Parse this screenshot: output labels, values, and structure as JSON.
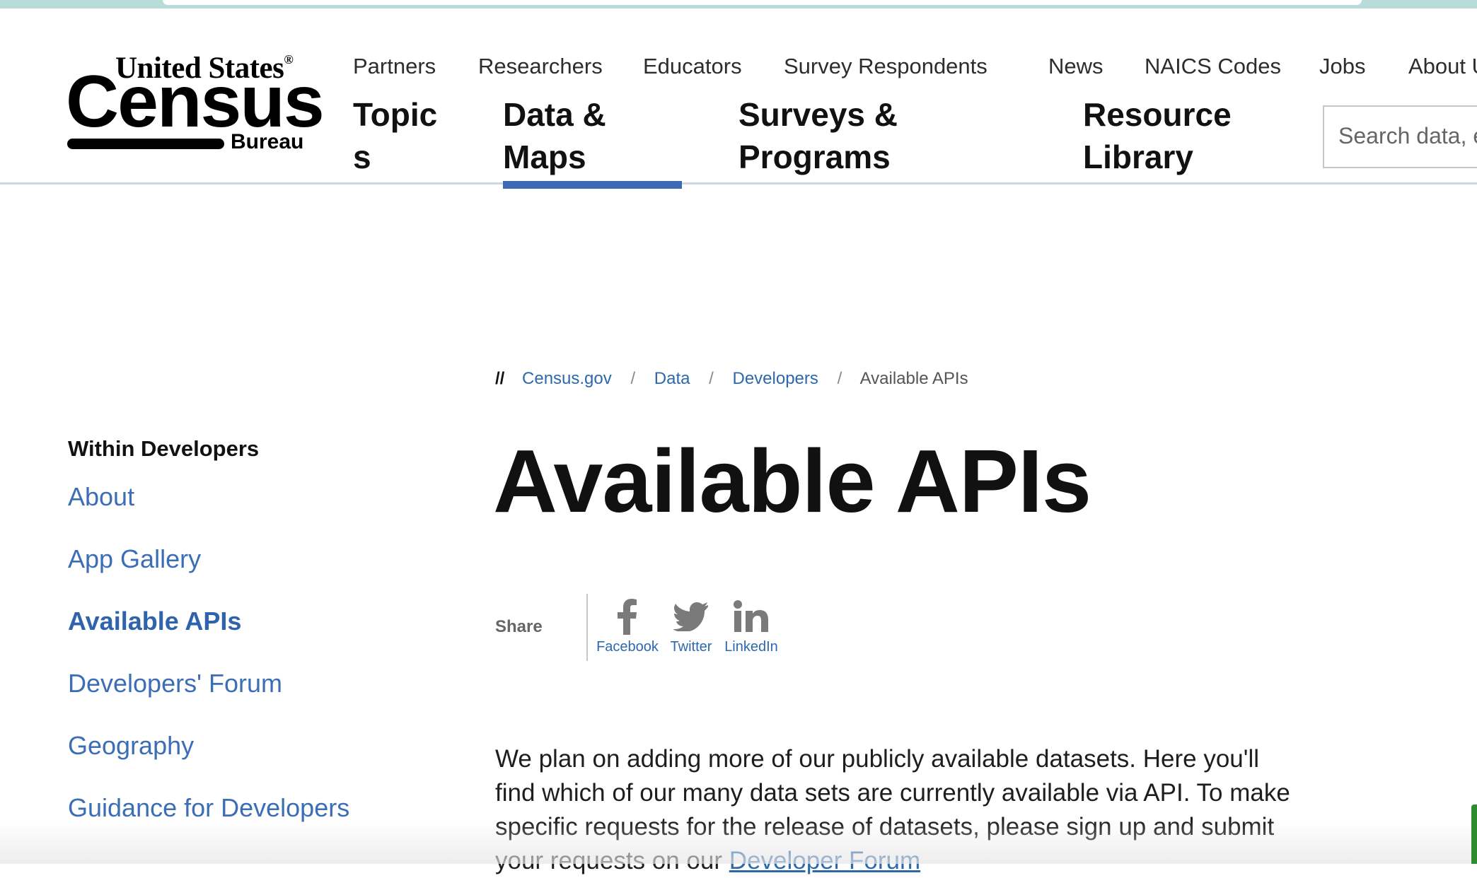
{
  "logo": {
    "line1": "United States",
    "reg": "®",
    "line2": "Census",
    "line3": "Bureau"
  },
  "utility_nav": [
    "Partners",
    "Researchers",
    "Educators",
    "Survey Respondents",
    "News",
    "NAICS Codes",
    "Jobs",
    "About U"
  ],
  "main_nav": [
    {
      "line1": "Topic",
      "line2": "s"
    },
    {
      "line1": "Data &",
      "line2": "Maps"
    },
    {
      "line1": "Surveys &",
      "line2": "Programs"
    },
    {
      "line1": "Resource",
      "line2": "Library"
    }
  ],
  "search": {
    "placeholder": "Search data, e"
  },
  "breadcrumb": {
    "prefix": "//",
    "items": [
      "Census.gov",
      "Data",
      "Developers"
    ],
    "separator": "/",
    "current": "Available APIs"
  },
  "sidebar": {
    "heading": "Within Developers",
    "items": [
      "About",
      "App Gallery",
      "Available APIs",
      "Developers' Forum",
      "Geography",
      "Guidance for Developers"
    ]
  },
  "page_title": "Available APIs",
  "share": {
    "label": "Share",
    "facebook": "Facebook",
    "twitter": "Twitter",
    "linkedin": "LinkedIn"
  },
  "intro": {
    "text": "We plan on adding more of our publicly available datasets. Here you'll find which of our many data sets are currently available via API. To make specific requests for the release of datasets, please sign up and submit your requests on our ",
    "link": "Developer Forum"
  },
  "colors": {
    "link": "#2d68ad",
    "accent": "#3e6ab5"
  }
}
